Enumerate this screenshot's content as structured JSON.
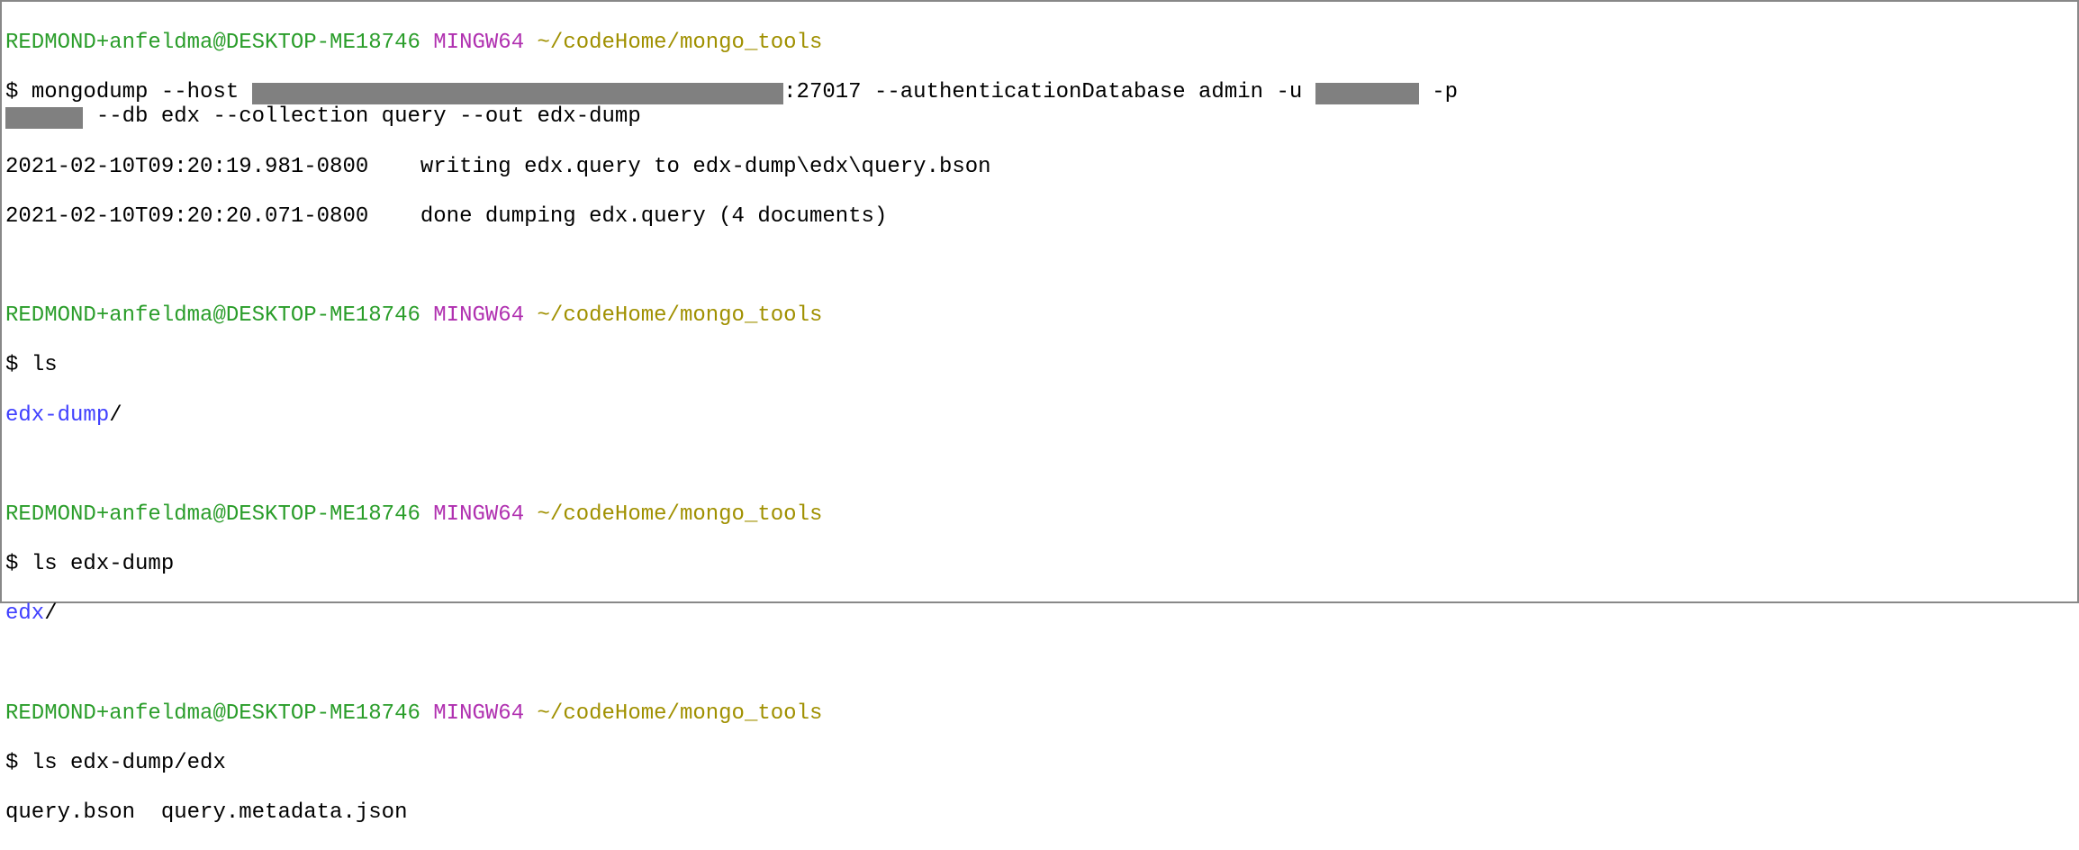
{
  "prompt": {
    "user_host": "REDMOND+anfeldma@DESKTOP-ME18746",
    "system": "MINGW64",
    "path": "~/codeHome/mongo_tools",
    "symbol": "$"
  },
  "block1": {
    "cmd_prefix": "mongodump --host ",
    "redacted_host_pad": "                                         ",
    "cmd_mid1": ":27017 --authenticationDatabase admin -u ",
    "redacted_user_pad": "        ",
    "cmd_mid2": " -p ",
    "redacted_pass_pad": "      ",
    "cmd_suffix": " --db edx --collection query --out edx-dump",
    "out1": "2021-02-10T09:20:19.981-0800    writing edx.query to edx-dump\\edx\\query.bson",
    "out2": "2021-02-10T09:20:20.071-0800    done dumping edx.query (4 documents)"
  },
  "block2": {
    "cmd": "ls",
    "out_dir": "edx-dump",
    "out_slash": "/"
  },
  "block3": {
    "cmd": "ls edx-dump",
    "out_dir": "edx",
    "out_slash": "/"
  },
  "block4": {
    "cmd": "ls edx-dump/edx",
    "out": "query.bson  query.metadata.json"
  }
}
